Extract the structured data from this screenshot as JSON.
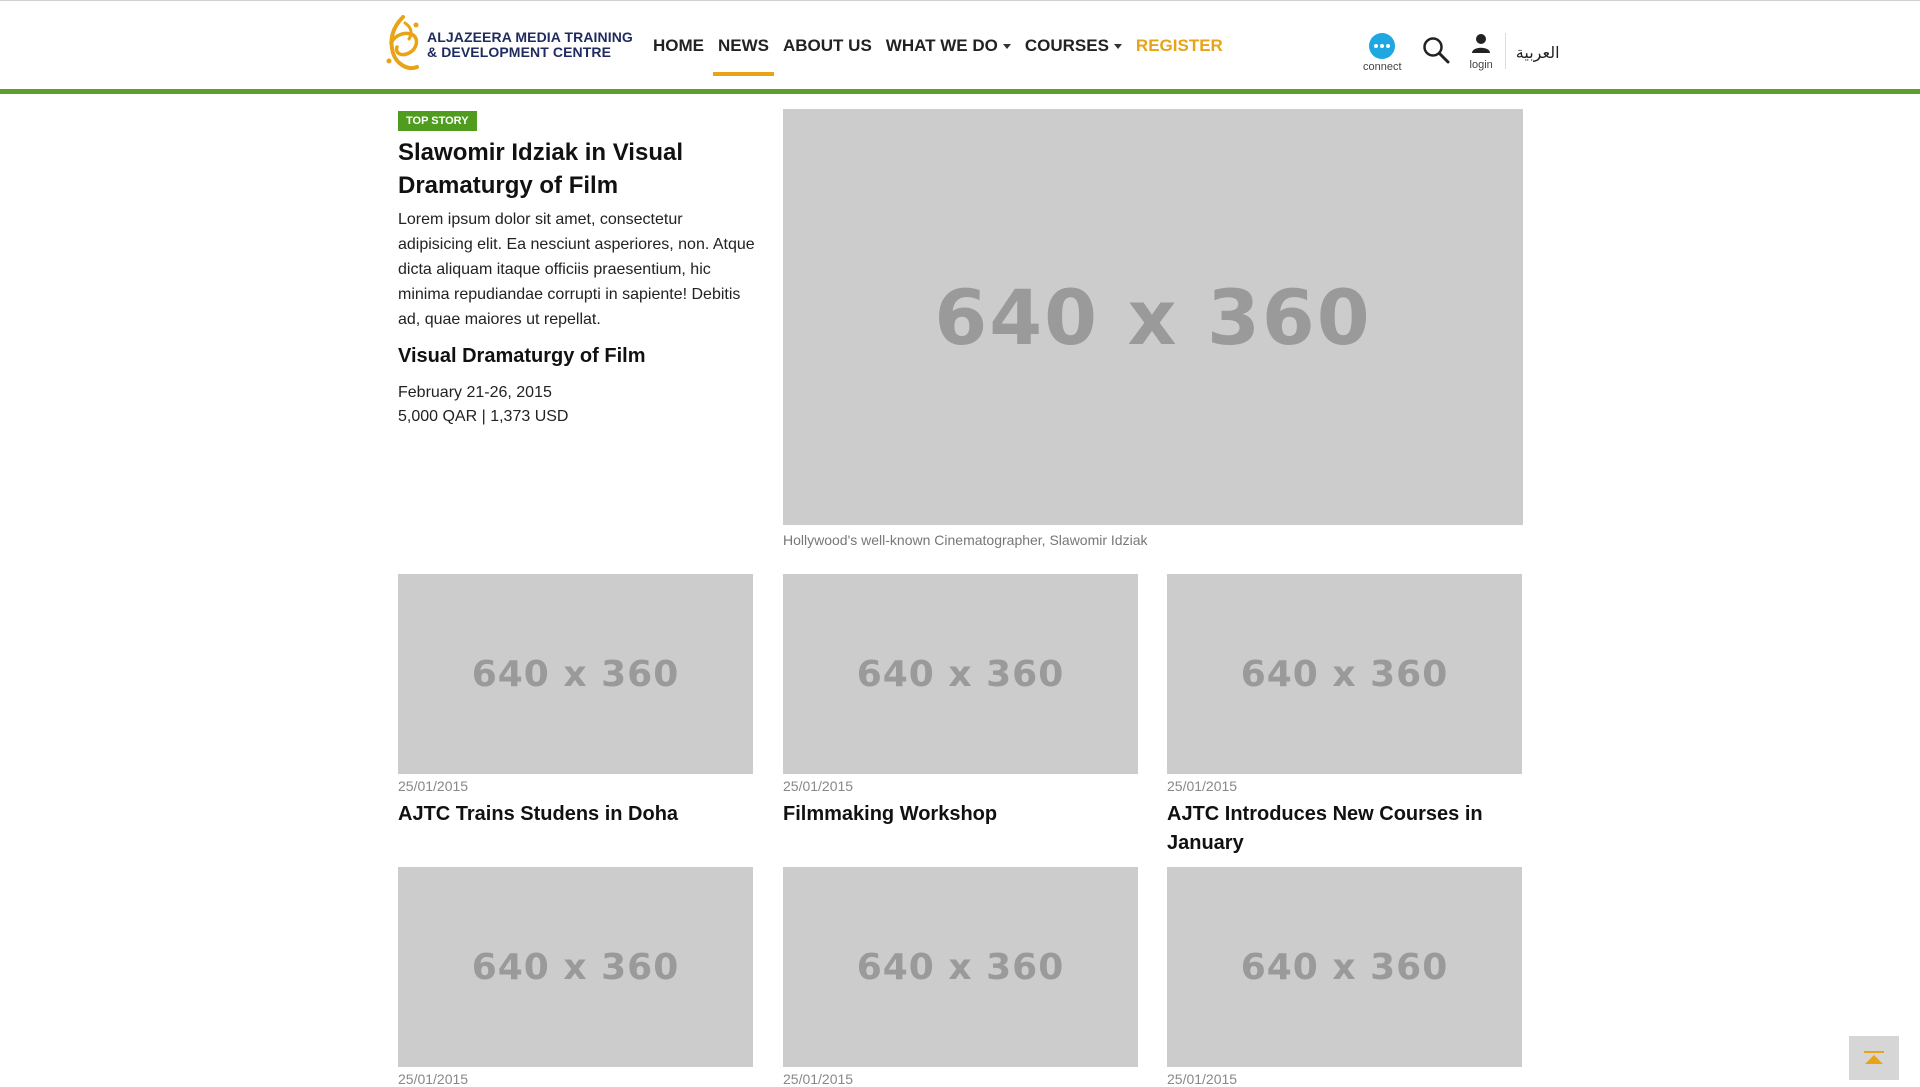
{
  "header": {
    "logo_line1": "ALJAZEERA MEDIA TRAINING",
    "logo_line2": "& DEVELOPMENT CENTRE",
    "nav": [
      "HOME",
      "NEWS",
      "ABOUT US",
      "WHAT WE DO",
      "COURSES",
      "REGISTER"
    ],
    "connect_label": "connect",
    "login_label": "login",
    "language_label": "العربية"
  },
  "top_story": {
    "badge": "TOP STORY",
    "title": "Slawomir Idziak in Visual Dramaturgy of Film",
    "body": "Lorem ipsum dolor sit amet, consectetur adipisicing elit. Ea nesciunt asperiores, non. Atque dicta aliquam itaque officiis praesentium, hic minima repudiandae corrupti in sapiente! Debitis ad, quae maiores ut repellat.",
    "course_title": "Visual Dramaturgy of Film",
    "dates": "February 21-26, 2015",
    "price": "5,000 QAR | 1,373 USD",
    "image_label": "640 x 360",
    "caption": "Hollywood's well-known Cinematographer, Slawomir Idziak"
  },
  "news": [
    {
      "image_label": "640 x 360",
      "date": "25/01/2015",
      "title": "AJTC Trains Studens in Doha"
    },
    {
      "image_label": "640 x 360",
      "date": "25/01/2015",
      "title": "Filmmaking Workshop"
    },
    {
      "image_label": "640 x 360",
      "date": "25/01/2015",
      "title": "AJTC Introduces New Courses in January"
    },
    {
      "image_label": "640 x 360",
      "date": "25/01/2015",
      "title": ""
    },
    {
      "image_label": "640 x 360",
      "date": "25/01/2015",
      "title": ""
    },
    {
      "image_label": "640 x 360",
      "date": "25/01/2015",
      "title": ""
    }
  ],
  "colors": {
    "accent_green": "#5aa02c",
    "accent_gold": "#e8a317",
    "connect_blue": "#1ea7e1",
    "logo_navy": "#1f2b5e"
  },
  "icons": {
    "logo": "aljazeera-logo-icon",
    "connect": "chat-bubble-icon",
    "search": "search-icon",
    "login": "user-icon",
    "back_to_top": "arrow-up-icon"
  }
}
